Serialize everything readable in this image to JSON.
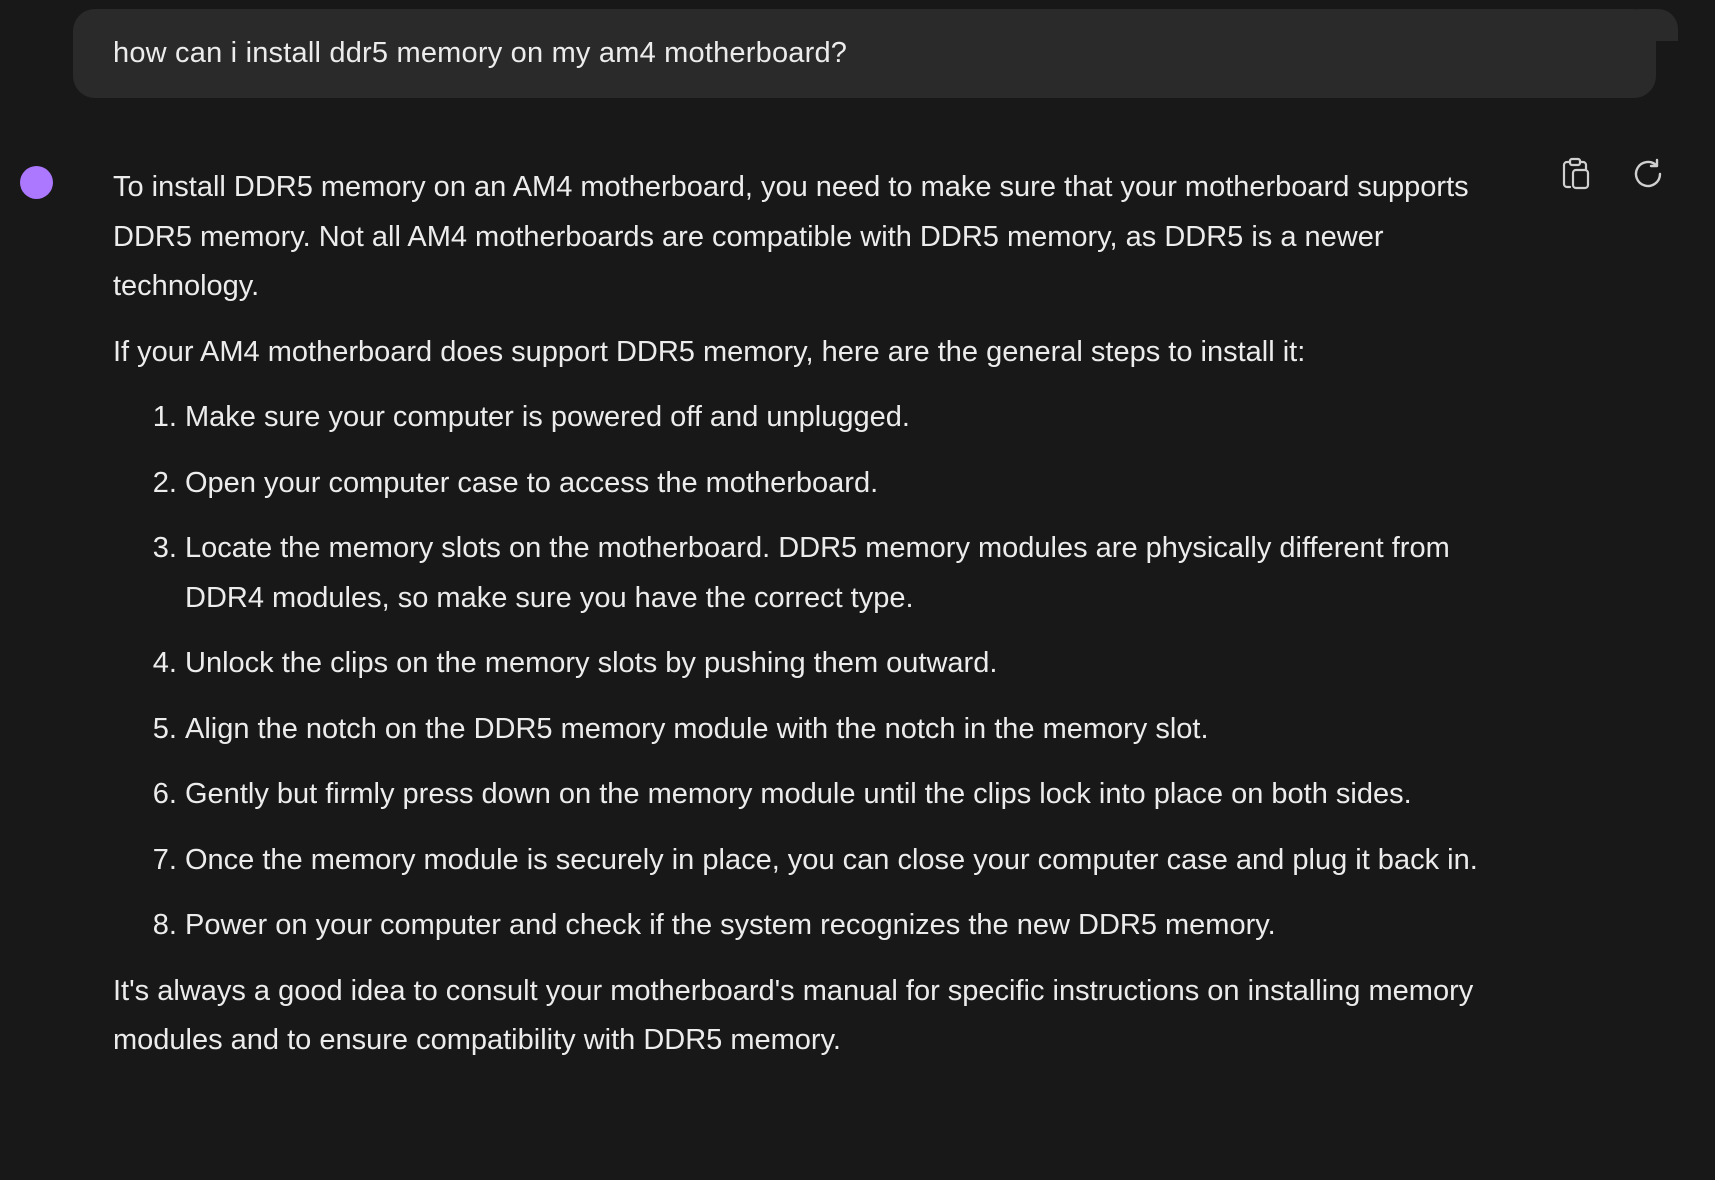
{
  "user_message": {
    "text": "how can i install ddr5 memory on my am4 motherboard?"
  },
  "assistant_message": {
    "avatar_color": "#ab78ff",
    "actions": {
      "copy_icon": "clipboard-icon",
      "regenerate_icon": "refresh-icon"
    },
    "intro": "To install DDR5 memory on an AM4 motherboard, you need to make sure that your motherboard supports DDR5 memory. Not all AM4 motherboards are compatible with DDR5 memory, as DDR5 is a newer technology.",
    "lead_in": "If your AM4 motherboard does support DDR5 memory, here are the general steps to install it:",
    "steps": [
      "Make sure your computer is powered off and unplugged.",
      "Open your computer case to access the motherboard.",
      "Locate the memory slots on the motherboard. DDR5 memory modules are physically different from DDR4 modules, so make sure you have the correct type.",
      "Unlock the clips on the memory slots by pushing them outward.",
      "Align the notch on the DDR5 memory module with the notch in the memory slot.",
      "Gently but firmly press down on the memory module until the clips lock into place on both sides.",
      "Once the memory module is securely in place, you can close your computer case and plug it back in.",
      "Power on your computer and check if the system recognizes the new DDR5 memory."
    ],
    "closing": "It's always a good idea to consult your motherboard's manual for specific instructions on installing memory modules and to ensure compatibility with DDR5 memory."
  },
  "colors": {
    "background": "#181818",
    "bubble": "#2a2a2a",
    "text": "#ececec",
    "accent": "#ab78ff"
  }
}
